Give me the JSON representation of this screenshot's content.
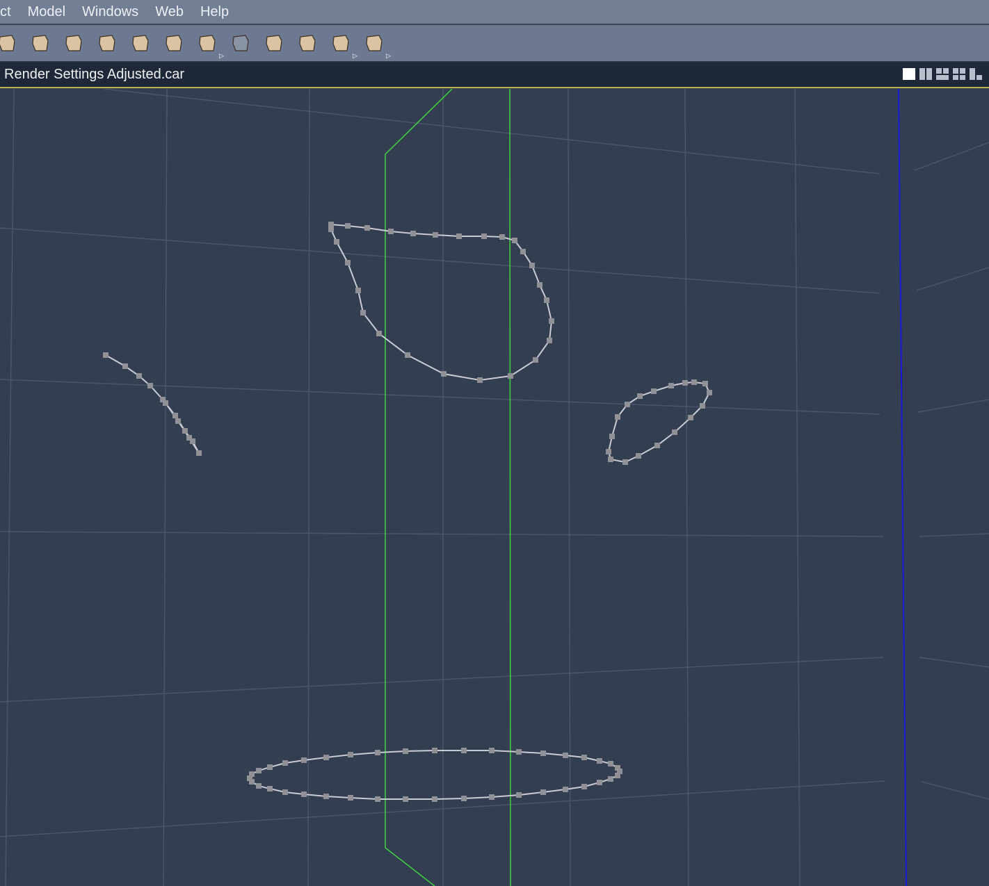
{
  "menubar": {
    "items": [
      "ct",
      "Model",
      "Windows",
      "Web",
      "Help"
    ]
  },
  "toolbar": {
    "tools": [
      "extrude-icon",
      "revolve-icon",
      "lathe-icon",
      "plane-icon",
      "box-icon",
      "sweep-icon",
      "sphere-icon",
      "line-icon",
      "loft-icon",
      "skin-icon",
      "shelve-icon",
      "deform-icon"
    ]
  },
  "document": {
    "title": "Render Settings Adjusted.car"
  },
  "layouts": [
    "single-view",
    "two-vertical",
    "two-horizontal",
    "four-view",
    "three-view"
  ],
  "colors": {
    "viewport": "#333e51",
    "axis_green": "#3fd23f",
    "axis_blue": "#1a1ad8",
    "curve": "#8f9196"
  }
}
